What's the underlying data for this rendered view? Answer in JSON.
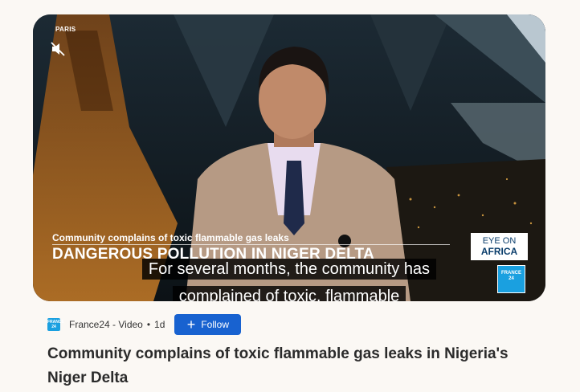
{
  "video": {
    "location": "PARIS",
    "lower_third_small": "Community complains of toxic flammable gas leaks",
    "lower_third_big": "DANGEROUS POLLUTION IN NIGER DELTA",
    "show_logo_line1": "EYE ON",
    "show_logo_line2": "AFRICA",
    "channel_badge": "FRANCE 24",
    "subtitle_line1": "For several months, the community has",
    "subtitle_line2": "complained of toxic, flammable",
    "mute_icon": "muted-speaker-icon"
  },
  "meta": {
    "source": "France24 - Video",
    "age": "1d",
    "follow_label": "Follow",
    "source_logo_text": "FRANCE 24"
  },
  "headline": "Community complains of toxic flammable gas leaks in Nigeria's Niger Delta",
  "colors": {
    "page_bg": "#fbf8f4",
    "follow_button": "#1862d0",
    "france24_blue": "#1aa0e0"
  }
}
